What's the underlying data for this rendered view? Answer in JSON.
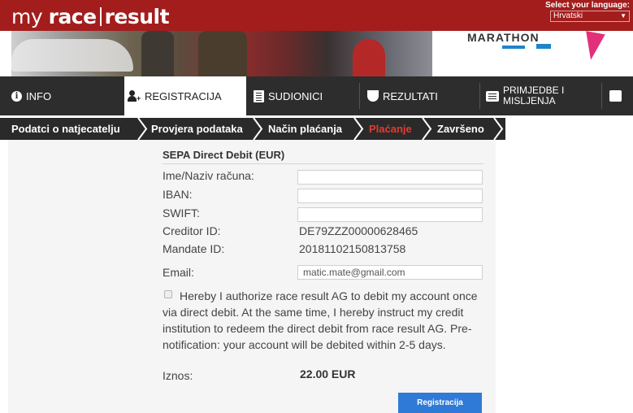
{
  "header": {
    "logo": {
      "part1": "my",
      "part2": "race",
      "part3": "result"
    },
    "language_label": "Select your language:",
    "language_selected": "Hrvatski"
  },
  "banner": {
    "text": "MARATHON"
  },
  "tabs": [
    {
      "label": "INFO",
      "icon": "info-icon"
    },
    {
      "label": "REGISTRACIJA",
      "icon": "add-user-icon"
    },
    {
      "label": "SUDIONICI",
      "icon": "list-icon"
    },
    {
      "label": "REZULTATI",
      "icon": "trophy-icon"
    },
    {
      "label": "PRIMJEDBE I",
      "label2": "MISLJENJA",
      "icon": "comment-icon"
    },
    {
      "label": "",
      "icon": "tray-icon"
    }
  ],
  "steps": [
    {
      "label": "Podatci o natjecatelju"
    },
    {
      "label": "Provjera podataka"
    },
    {
      "label": "Način plaćanja"
    },
    {
      "label": "Plaćanje",
      "active": true
    },
    {
      "label": "Završeno"
    }
  ],
  "form": {
    "title": "SEPA Direct Debit (EUR)",
    "account_name_label": "Ime/Naziv računa:",
    "account_name_value": "",
    "iban_label": "IBAN:",
    "iban_value": "",
    "swift_label": "SWIFT:",
    "swift_value": "",
    "creditor_label": "Creditor ID:",
    "creditor_value": "DE79ZZZ00000628465",
    "mandate_label": "Mandate ID:",
    "mandate_value": "20181102150813758",
    "email_label": "Email:",
    "email_value": "matic.mate@gmail.com",
    "consent_text": "Hereby I authorize race result AG to debit my account once via direct debit. At the same time, I hereby instruct my credit institution to redeem the direct debit from race result AG. Pre-notification: your account will be debited within 2-5 days.",
    "amount_label": "Iznos:",
    "amount_value": "22.00 EUR",
    "submit_label": "Registracija"
  },
  "colors": {
    "brand_red": "#a31d1d",
    "nav_dark": "#2d2d2d",
    "active_step": "#e8392d",
    "button_blue": "#2f7ad6"
  }
}
